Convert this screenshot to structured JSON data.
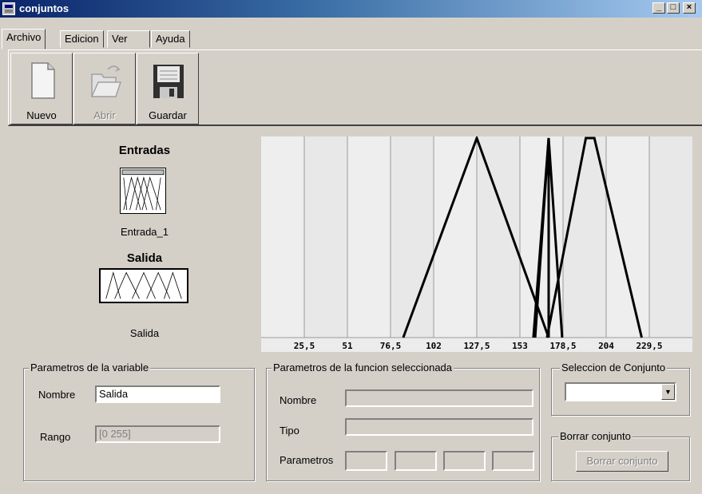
{
  "window": {
    "title": "conjuntos",
    "buttons": [
      "_",
      "□",
      "×"
    ]
  },
  "menu": {
    "items": [
      "Archivo",
      "Edicion",
      "Ver",
      "Ayuda"
    ],
    "active": "Archivo"
  },
  "toolbar": {
    "nuevo_label": "Nuevo",
    "abrir_label": "Abrir",
    "guardar_label": "Guardar"
  },
  "left_panel": {
    "inputs_title": "Entradas",
    "input_var_name": "Entrada_1",
    "output_title": "Salida",
    "output_var_name": "Salida"
  },
  "chart_data": {
    "type": "line",
    "title": "",
    "xlabel": "",
    "ylabel": "",
    "xlim": [
      0,
      255
    ],
    "ylim": [
      0,
      1
    ],
    "grid": true,
    "x_ticks": [
      "25,5",
      "51",
      "76,5",
      "102",
      "127,5",
      "153",
      "178,5",
      "204",
      "229,5"
    ],
    "x_tick_values": [
      25.5,
      51,
      76.5,
      102,
      127.5,
      153,
      178.5,
      204,
      229.5
    ],
    "series": [
      {
        "x": [
          84,
          127.5,
          170
        ],
        "y": [
          0,
          1,
          0
        ]
      },
      {
        "x": [
          161,
          170,
          170
        ],
        "y": [
          0,
          1,
          0
        ]
      },
      {
        "x": [
          162,
          170,
          178
        ],
        "y": [
          0,
          1,
          0
        ]
      },
      {
        "x": [
          169,
          192,
          197,
          225
        ],
        "y": [
          0,
          1,
          1,
          0
        ]
      }
    ]
  },
  "variable_params": {
    "group_title": "Parametros de la variable",
    "nombre_label": "Nombre",
    "nombre_value": "Salida",
    "rango_label": "Rango",
    "rango_value": "[0 255]"
  },
  "function_params": {
    "group_title": "Parametros de la funcion seleccionada",
    "nombre_label": "Nombre",
    "tipo_label": "Tipo",
    "parametros_label": "Parametros"
  },
  "set_selection": {
    "group_title": "Seleccion de Conjunto",
    "selected": ""
  },
  "delete_set": {
    "group_title": "Borrar conjunto",
    "button_label": "Borrar conjunto"
  }
}
